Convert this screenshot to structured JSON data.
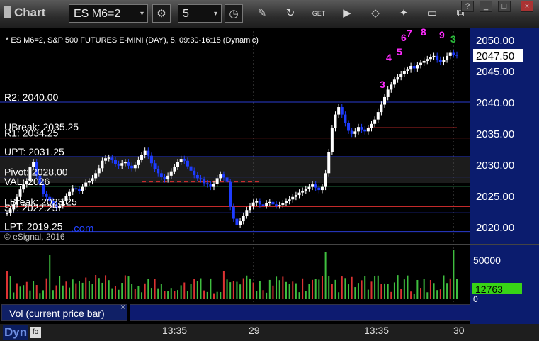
{
  "window": {
    "title": "Chart",
    "symbol": "ES M6=2",
    "interval": "5",
    "buttons": [
      "gear-icon",
      "clock-icon",
      "pencil-icon",
      "refresh-icon",
      "get-icon",
      "play-icon",
      "eraser-icon",
      "chat-icon",
      "drawing-icon",
      "new-window-icon"
    ],
    "window_controls": [
      "?",
      "_",
      "□",
      "×"
    ]
  },
  "chart": {
    "heading": "* ES M6=2, S&P 500 FUTURES E-MINI (DAY), 5, 09:30-16:15 (Dynamic)",
    "current_price": "2047.50",
    "price_axis": [
      "2050.00",
      "2045.00",
      "2040.00",
      "2035.00",
      "2030.00",
      "2025.00",
      "2020.00"
    ],
    "level_labels": [
      {
        "text": "R2: 2040.00",
        "price": 2040.0
      },
      {
        "text": "UBreak: 2035.25",
        "price": 2035.25
      },
      {
        "text": "R1: 2034.25",
        "price": 2034.25
      },
      {
        "text": "UPT: 2031.25",
        "price": 2031.25
      },
      {
        "text": "Pivot: 2028.00",
        "price": 2028.0
      },
      {
        "text": "VAL: 2026",
        "price": 2026.5
      },
      {
        "text": "LBreak: 2023.25",
        "price": 2023.25
      },
      {
        "text": "S1: 2022.25",
        "price": 2022.25
      },
      {
        "text": "LPT: 2019.25",
        "price": 2019.25
      }
    ],
    "watermark": ".com",
    "copyright": "© eSignal, 2016",
    "counts": [
      "4",
      "3",
      "5",
      "6",
      "7",
      "8",
      "9",
      "3"
    ],
    "colors": {
      "up": "#ffffff",
      "down": "#1e3cff",
      "level_blue": "#2a3bd0",
      "level_red": "#e03030",
      "level_green": "#3fd47a",
      "magenta": "#ff2cff",
      "seq_green": "#2bbb3b"
    }
  },
  "volume": {
    "axis": [
      "50000",
      "0"
    ],
    "current": "12763",
    "study_label": "Vol (current price bar)",
    "close_glyph": "×"
  },
  "time_axis": {
    "labels": [
      "13:35",
      "29",
      "13:35",
      "30"
    ],
    "status": "Dyn"
  }
}
